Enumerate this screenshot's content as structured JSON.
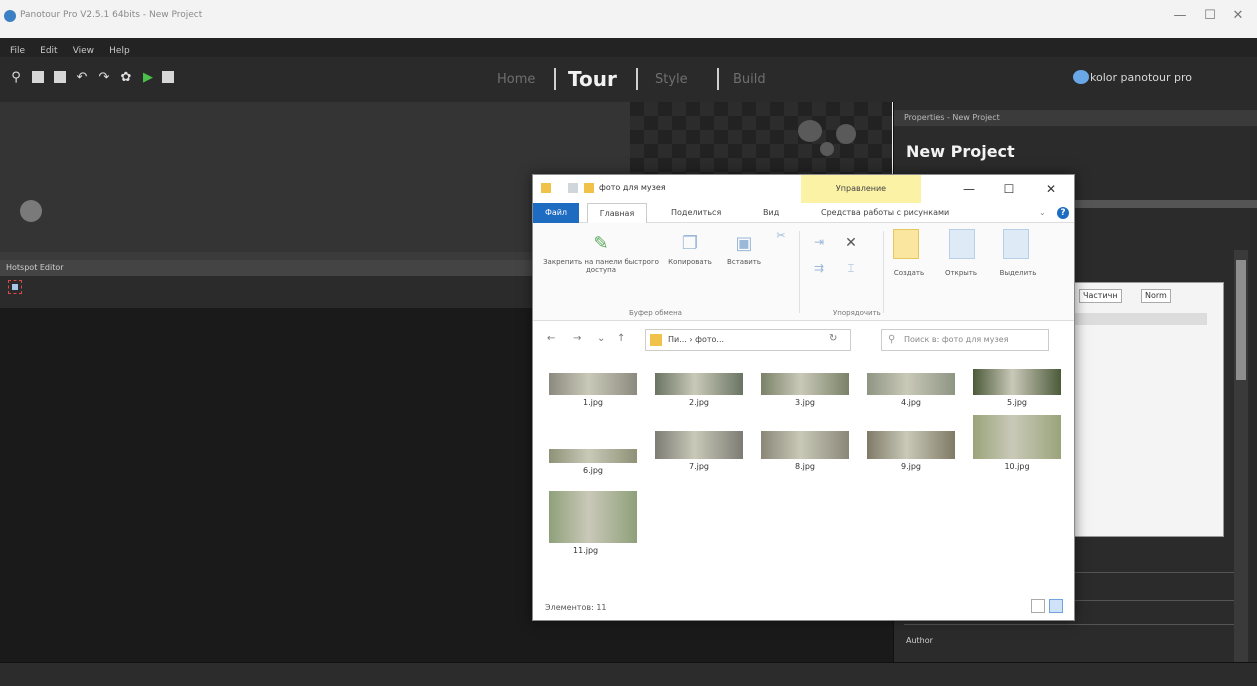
{
  "host": {
    "title": "Panotour Pro V2.5.1 64bits - New Project",
    "controls": {
      "minimize": "—",
      "maximize": "☐",
      "close": "✕"
    }
  },
  "menu": [
    "File",
    "Edit",
    "View",
    "Help"
  ],
  "toolbar": {
    "icons": [
      "search-icon",
      "save-icon",
      "save-as-icon",
      "undo-icon",
      "redo-icon",
      "settings-icon",
      "play-icon",
      "build-icon"
    ],
    "tabs": [
      "Home",
      "Tour",
      "Style",
      "Build"
    ],
    "active_tab": "Tour",
    "brand": "kolor panotour pro"
  },
  "properties": {
    "header": "Properties - New Project",
    "title": "New Project",
    "author_label": "Author",
    "list_buttons": [
      "Частичн",
      "Norm"
    ]
  },
  "hotspot_editor": {
    "header": "Hotspot Editor"
  },
  "explorer": {
    "title": "фото для музея",
    "manage_tab": "Управление",
    "window_controls": {
      "minimize": "—",
      "maximize": "☐",
      "close": "✕"
    },
    "tabs": [
      "Файл",
      "Главная",
      "Поделиться",
      "Вид",
      "Средства работы с рисунками"
    ],
    "ribbon": {
      "pin_label": "Закрепить на панели быстрого доступа",
      "copy_label": "Копировать",
      "paste_label": "Вставить",
      "create_label": "Создать",
      "open_label": "Открыть",
      "select_label": "Выделить",
      "group_clipboard": "Буфер обмена",
      "group_organize": "Упорядочить"
    },
    "address": "Пи... › фото...",
    "search_placeholder": "Поиск в: фото для музея",
    "files": [
      {
        "name": "1.jpg",
        "color": "#8c8a7f"
      },
      {
        "name": "2.jpg",
        "color": "#6a7462"
      },
      {
        "name": "3.jpg",
        "color": "#7a8268"
      },
      {
        "name": "4.jpg",
        "color": "#8f9583"
      },
      {
        "name": "5.jpg",
        "color": "#4c5a3a"
      },
      {
        "name": "6.jpg",
        "color": "#8e9276"
      },
      {
        "name": "7.jpg",
        "color": "#7c7c74"
      },
      {
        "name": "8.jpg",
        "color": "#8a8778"
      },
      {
        "name": "9.jpg",
        "color": "#7f7a66"
      },
      {
        "name": "10.jpg",
        "color": "#9aa47a"
      },
      {
        "name": "11.jpg",
        "color": "#8fa07a"
      }
    ],
    "status": "Элементов: 11"
  }
}
